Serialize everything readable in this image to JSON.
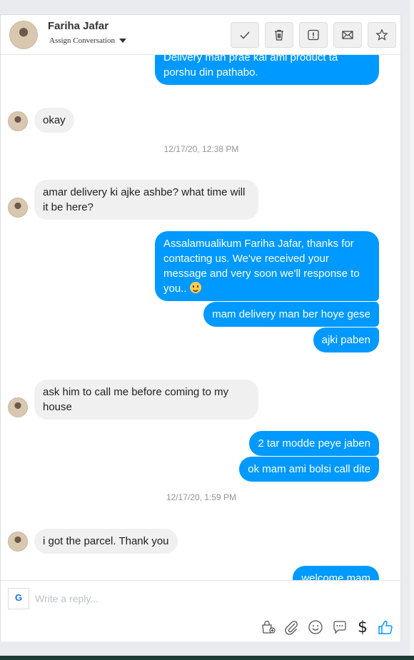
{
  "header": {
    "contact_name": "Fariha Jafar",
    "assign_label": "Assign Conversation",
    "actions": [
      {
        "name": "check-icon"
      },
      {
        "name": "trash-icon"
      },
      {
        "name": "spam-icon"
      },
      {
        "name": "mail-icon"
      },
      {
        "name": "star-icon"
      }
    ]
  },
  "thread": {
    "messages": [
      {
        "direction": "out",
        "text": "Delivery man prae kal ami product ta porshu din pathabo."
      },
      {
        "direction": "in",
        "text": "okay"
      },
      {
        "type": "timestamp",
        "text": "12/17/20, 12:38 PM"
      },
      {
        "direction": "in",
        "text": "amar delivery ki ajke ashbe? what time will it be here?"
      },
      {
        "direction": "out",
        "text": "Assalamualikum  Fariha Jafar, thanks for contacting us. We've received your message and very soon we'll response to you.. ",
        "emoji": "slightly-smiling-face"
      },
      {
        "direction": "out",
        "text": "mam delivery man ber hoye gese"
      },
      {
        "direction": "out",
        "text": "ajki paben"
      },
      {
        "direction": "in",
        "text": "ask him to call me before coming to my house"
      },
      {
        "direction": "out",
        "text": "2 tar modde peye jaben"
      },
      {
        "direction": "out",
        "text": "ok mam ami bolsi call dite"
      },
      {
        "type": "timestamp",
        "text": "12/17/20, 1:59 PM"
      },
      {
        "direction": "in",
        "text": "i got the parcel. Thank you"
      },
      {
        "direction": "out",
        "text": "welcome mam"
      }
    ]
  },
  "composer": {
    "placeholder": "Write a reply...",
    "app_logo_letter": "G",
    "tools": [
      "bag-icon",
      "attach-icon",
      "emoji-icon",
      "saved-reply-icon",
      "dollar-icon",
      "like-icon"
    ],
    "dollar_symbol": "$"
  },
  "colors": {
    "outgoing_bubble": "#0099ff",
    "incoming_bubble": "#f0f0f0",
    "like_icon": "#0099ff"
  }
}
